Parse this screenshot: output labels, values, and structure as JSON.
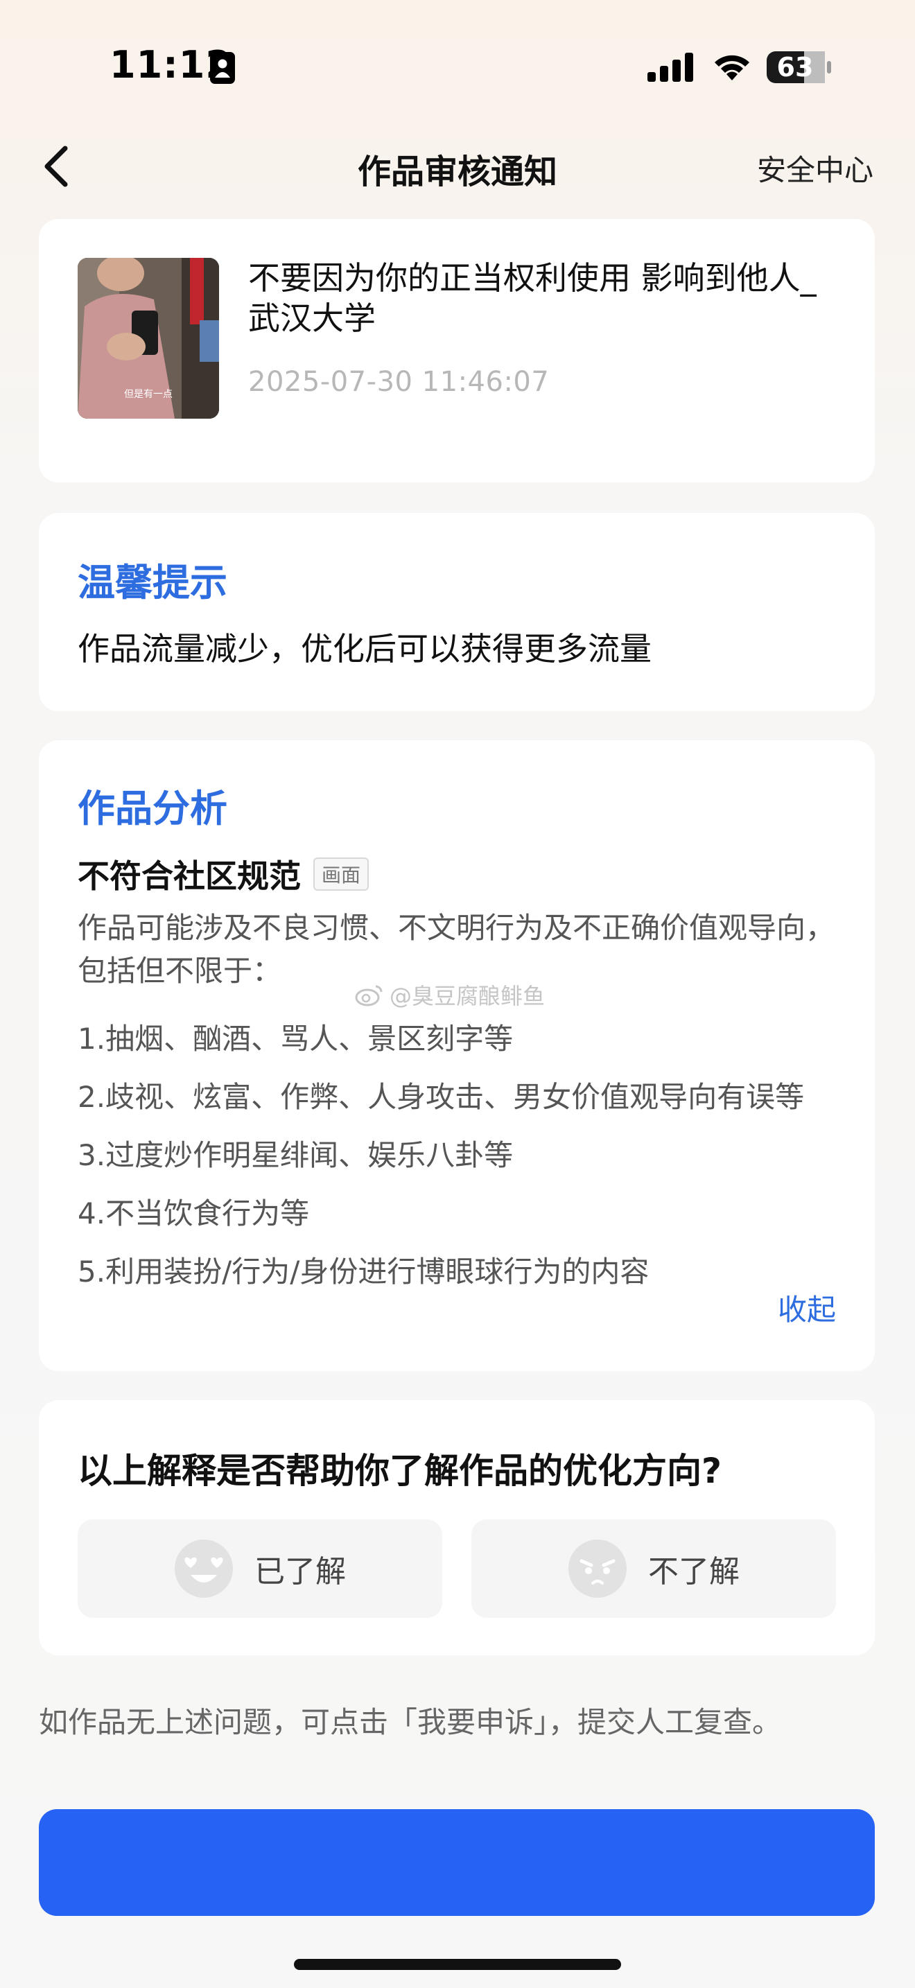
{
  "status_bar": {
    "time": "11:12",
    "battery_level": "63"
  },
  "nav": {
    "title": "作品审核通知",
    "right_link": "安全中心",
    "back_icon": "chevron-left-icon"
  },
  "video": {
    "thumbnail_caption": "但是有一点",
    "title": "不要因为你的正当权利使用 影响到他人_ 武汉大学",
    "timestamp": "2025-07-30 11:46:07"
  },
  "tip": {
    "heading": "温馨提示",
    "text": "作品流量减少，优化后可以获得更多流量"
  },
  "analysis": {
    "heading": "作品分析",
    "violation_title": "不符合社区规范",
    "violation_tag": "画面",
    "description": "作品可能涉及不良习惯、不文明行为及不正确价值观导向，包括但不限于：",
    "items": [
      "1.抽烟、酗酒、骂人、景区刻字等",
      "2.歧视、炫富、作弊、人身攻击、男女价值观导向有误等",
      "3.过度炒作明星绯闻、娱乐八卦等",
      "4.不当饮食行为等",
      "5.利用装扮/行为/身份进行博眼球行为的内容"
    ],
    "collapse_label": "收起"
  },
  "watermark": "@臭豆腐酿鲱鱼",
  "feedback": {
    "question": "以上解释是否帮助你了解作品的优化方向?",
    "yes_label": "已了解",
    "no_label": "不了解"
  },
  "appeal": {
    "note": "如作品无上述问题，可点击「我要申诉」，提交人工复查。",
    "button_label": ""
  },
  "colors": {
    "accent_blue": "#2e6de0",
    "button_blue": "#2662f4"
  }
}
